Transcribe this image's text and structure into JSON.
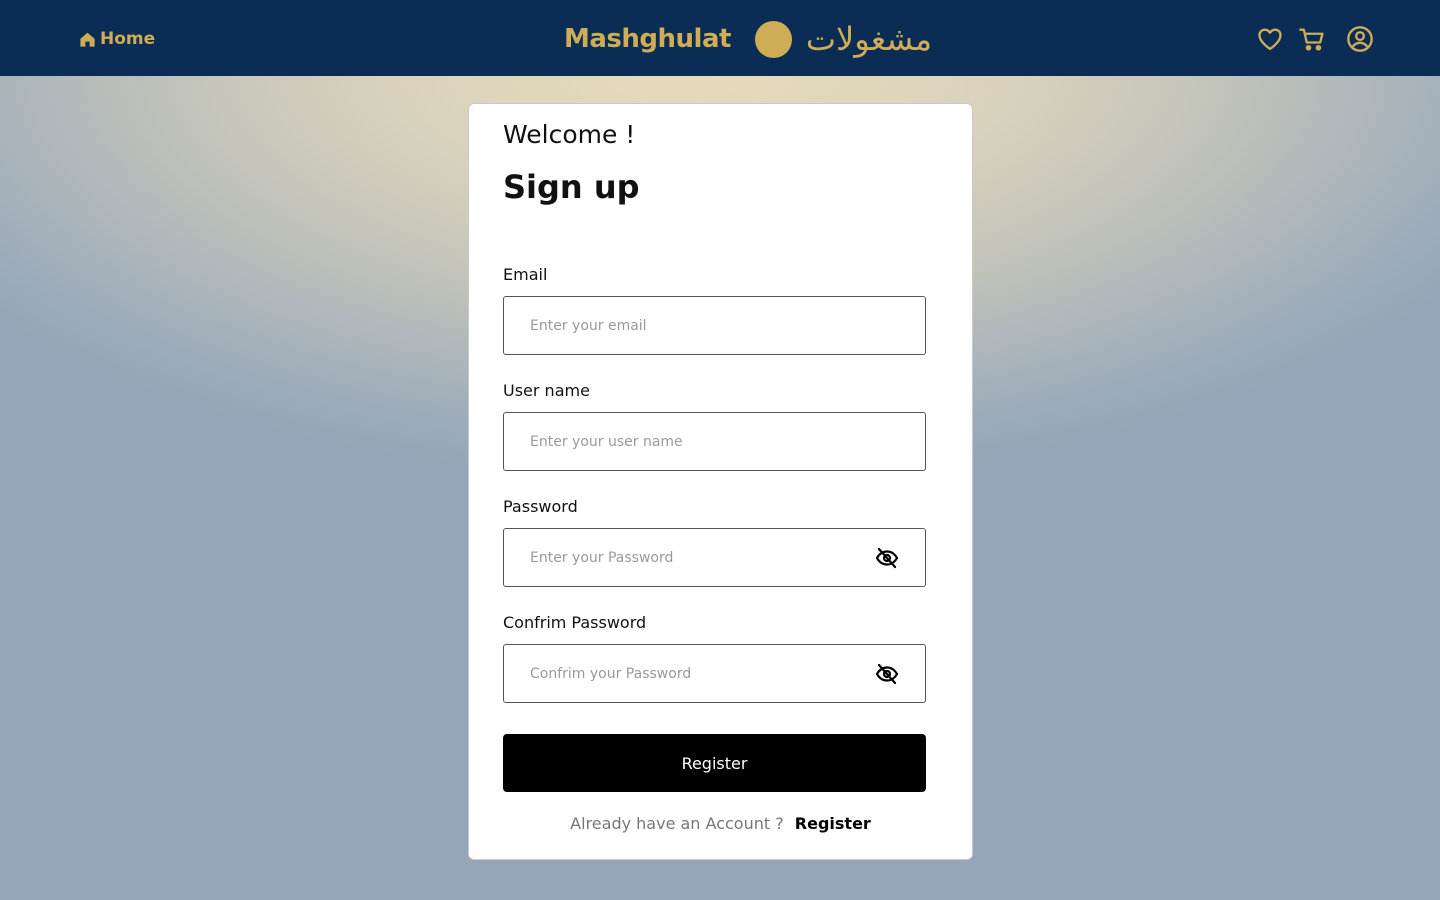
{
  "header": {
    "home_label": "Home",
    "brand_name": "Mashghulat",
    "brand_arabic": "مشغولات",
    "icons": [
      "home-icon",
      "heart-icon",
      "cart-icon",
      "user-circle-icon"
    ]
  },
  "colors": {
    "header_bg": "#0b2d55",
    "accent_gold": "#cfad55",
    "button_bg": "#000000"
  },
  "form": {
    "welcome": "Welcome !",
    "title": "Sign up",
    "email": {
      "label": "Email",
      "placeholder": "Enter your email",
      "value": ""
    },
    "username": {
      "label": "User name",
      "placeholder": "Enter your user name",
      "value": ""
    },
    "password": {
      "label": "Password",
      "placeholder": "Enter your Password",
      "value": "",
      "icon": "eye-off-icon"
    },
    "confirm_password": {
      "label": "Confrim Password",
      "placeholder": "Confrim your Password",
      "value": "",
      "icon": "eye-off-icon"
    },
    "submit_label": "Register",
    "account_prompt": "Already have an Account ?",
    "account_link": "Register"
  }
}
